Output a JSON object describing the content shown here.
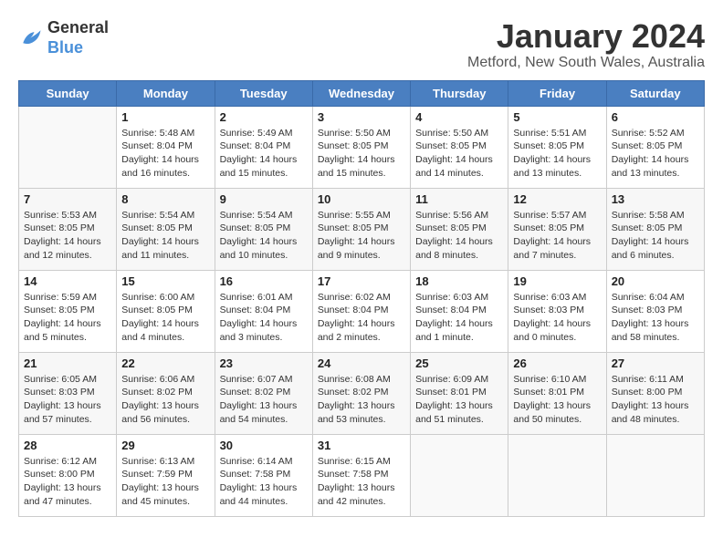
{
  "header": {
    "logo_line1": "General",
    "logo_line2": "Blue",
    "title": "January 2024",
    "subtitle": "Metford, New South Wales, Australia"
  },
  "weekdays": [
    "Sunday",
    "Monday",
    "Tuesday",
    "Wednesday",
    "Thursday",
    "Friday",
    "Saturday"
  ],
  "weeks": [
    [
      {
        "day": "",
        "info": ""
      },
      {
        "day": "1",
        "info": "Sunrise: 5:48 AM\nSunset: 8:04 PM\nDaylight: 14 hours\nand 16 minutes."
      },
      {
        "day": "2",
        "info": "Sunrise: 5:49 AM\nSunset: 8:04 PM\nDaylight: 14 hours\nand 15 minutes."
      },
      {
        "day": "3",
        "info": "Sunrise: 5:50 AM\nSunset: 8:05 PM\nDaylight: 14 hours\nand 15 minutes."
      },
      {
        "day": "4",
        "info": "Sunrise: 5:50 AM\nSunset: 8:05 PM\nDaylight: 14 hours\nand 14 minutes."
      },
      {
        "day": "5",
        "info": "Sunrise: 5:51 AM\nSunset: 8:05 PM\nDaylight: 14 hours\nand 13 minutes."
      },
      {
        "day": "6",
        "info": "Sunrise: 5:52 AM\nSunset: 8:05 PM\nDaylight: 14 hours\nand 13 minutes."
      }
    ],
    [
      {
        "day": "7",
        "info": "Sunrise: 5:53 AM\nSunset: 8:05 PM\nDaylight: 14 hours\nand 12 minutes."
      },
      {
        "day": "8",
        "info": "Sunrise: 5:54 AM\nSunset: 8:05 PM\nDaylight: 14 hours\nand 11 minutes."
      },
      {
        "day": "9",
        "info": "Sunrise: 5:54 AM\nSunset: 8:05 PM\nDaylight: 14 hours\nand 10 minutes."
      },
      {
        "day": "10",
        "info": "Sunrise: 5:55 AM\nSunset: 8:05 PM\nDaylight: 14 hours\nand 9 minutes."
      },
      {
        "day": "11",
        "info": "Sunrise: 5:56 AM\nSunset: 8:05 PM\nDaylight: 14 hours\nand 8 minutes."
      },
      {
        "day": "12",
        "info": "Sunrise: 5:57 AM\nSunset: 8:05 PM\nDaylight: 14 hours\nand 7 minutes."
      },
      {
        "day": "13",
        "info": "Sunrise: 5:58 AM\nSunset: 8:05 PM\nDaylight: 14 hours\nand 6 minutes."
      }
    ],
    [
      {
        "day": "14",
        "info": "Sunrise: 5:59 AM\nSunset: 8:05 PM\nDaylight: 14 hours\nand 5 minutes."
      },
      {
        "day": "15",
        "info": "Sunrise: 6:00 AM\nSunset: 8:05 PM\nDaylight: 14 hours\nand 4 minutes."
      },
      {
        "day": "16",
        "info": "Sunrise: 6:01 AM\nSunset: 8:04 PM\nDaylight: 14 hours\nand 3 minutes."
      },
      {
        "day": "17",
        "info": "Sunrise: 6:02 AM\nSunset: 8:04 PM\nDaylight: 14 hours\nand 2 minutes."
      },
      {
        "day": "18",
        "info": "Sunrise: 6:03 AM\nSunset: 8:04 PM\nDaylight: 14 hours\nand 1 minute."
      },
      {
        "day": "19",
        "info": "Sunrise: 6:03 AM\nSunset: 8:03 PM\nDaylight: 14 hours\nand 0 minutes."
      },
      {
        "day": "20",
        "info": "Sunrise: 6:04 AM\nSunset: 8:03 PM\nDaylight: 13 hours\nand 58 minutes."
      }
    ],
    [
      {
        "day": "21",
        "info": "Sunrise: 6:05 AM\nSunset: 8:03 PM\nDaylight: 13 hours\nand 57 minutes."
      },
      {
        "day": "22",
        "info": "Sunrise: 6:06 AM\nSunset: 8:02 PM\nDaylight: 13 hours\nand 56 minutes."
      },
      {
        "day": "23",
        "info": "Sunrise: 6:07 AM\nSunset: 8:02 PM\nDaylight: 13 hours\nand 54 minutes."
      },
      {
        "day": "24",
        "info": "Sunrise: 6:08 AM\nSunset: 8:02 PM\nDaylight: 13 hours\nand 53 minutes."
      },
      {
        "day": "25",
        "info": "Sunrise: 6:09 AM\nSunset: 8:01 PM\nDaylight: 13 hours\nand 51 minutes."
      },
      {
        "day": "26",
        "info": "Sunrise: 6:10 AM\nSunset: 8:01 PM\nDaylight: 13 hours\nand 50 minutes."
      },
      {
        "day": "27",
        "info": "Sunrise: 6:11 AM\nSunset: 8:00 PM\nDaylight: 13 hours\nand 48 minutes."
      }
    ],
    [
      {
        "day": "28",
        "info": "Sunrise: 6:12 AM\nSunset: 8:00 PM\nDaylight: 13 hours\nand 47 minutes."
      },
      {
        "day": "29",
        "info": "Sunrise: 6:13 AM\nSunset: 7:59 PM\nDaylight: 13 hours\nand 45 minutes."
      },
      {
        "day": "30",
        "info": "Sunrise: 6:14 AM\nSunset: 7:58 PM\nDaylight: 13 hours\nand 44 minutes."
      },
      {
        "day": "31",
        "info": "Sunrise: 6:15 AM\nSunset: 7:58 PM\nDaylight: 13 hours\nand 42 minutes."
      },
      {
        "day": "",
        "info": ""
      },
      {
        "day": "",
        "info": ""
      },
      {
        "day": "",
        "info": ""
      }
    ]
  ]
}
